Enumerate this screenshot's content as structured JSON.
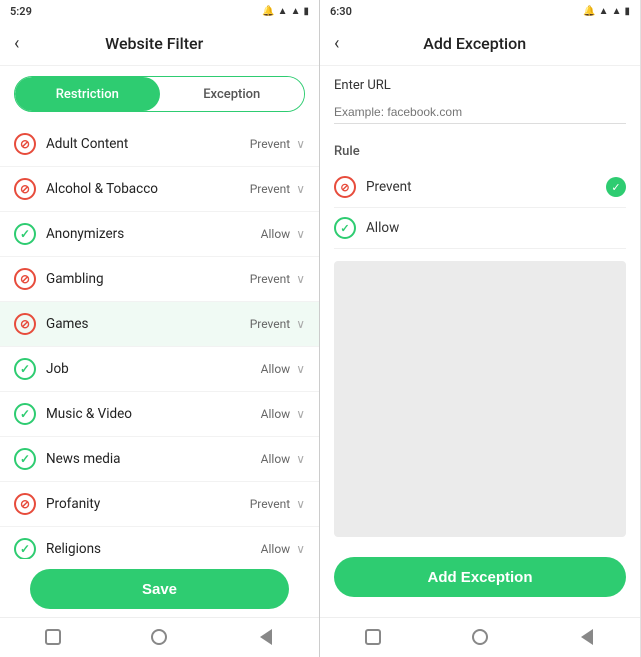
{
  "left": {
    "statusBar": {
      "time": "5:29",
      "icons": "🔔 📶 🔋"
    },
    "header": {
      "back": "‹",
      "title": "Website Filter"
    },
    "tabs": {
      "restriction": "Restriction",
      "exception": "Exception"
    },
    "filters": [
      {
        "name": "Adult Content",
        "status": "Prevent",
        "type": "prevent"
      },
      {
        "name": "Alcohol & Tobacco",
        "status": "Prevent",
        "type": "prevent"
      },
      {
        "name": "Anonymizers",
        "status": "Allow",
        "type": "allow"
      },
      {
        "name": "Gambling",
        "status": "Prevent",
        "type": "prevent"
      },
      {
        "name": "Games",
        "status": "Prevent",
        "type": "prevent"
      },
      {
        "name": "Job",
        "status": "Allow",
        "type": "allow"
      },
      {
        "name": "Music & Video",
        "status": "Allow",
        "type": "allow"
      },
      {
        "name": "News media",
        "status": "Allow",
        "type": "allow"
      },
      {
        "name": "Profanity",
        "status": "Prevent",
        "type": "prevent"
      },
      {
        "name": "Religions",
        "status": "Allow",
        "type": "allow"
      }
    ],
    "saveButton": "Save"
  },
  "right": {
    "statusBar": {
      "time": "6:30",
      "icons": "🔔 📶 🔋"
    },
    "header": {
      "back": "‹",
      "title": "Add Exception"
    },
    "urlLabel": "Enter URL",
    "urlPlaceholder": "Example: facebook.com",
    "ruleLabel": "Rule",
    "ruleOptions": [
      {
        "label": "Prevent",
        "type": "prevent",
        "selected": false
      },
      {
        "label": "Allow",
        "type": "allow",
        "selected": false
      }
    ],
    "addExceptionButton": "Add Exception"
  }
}
